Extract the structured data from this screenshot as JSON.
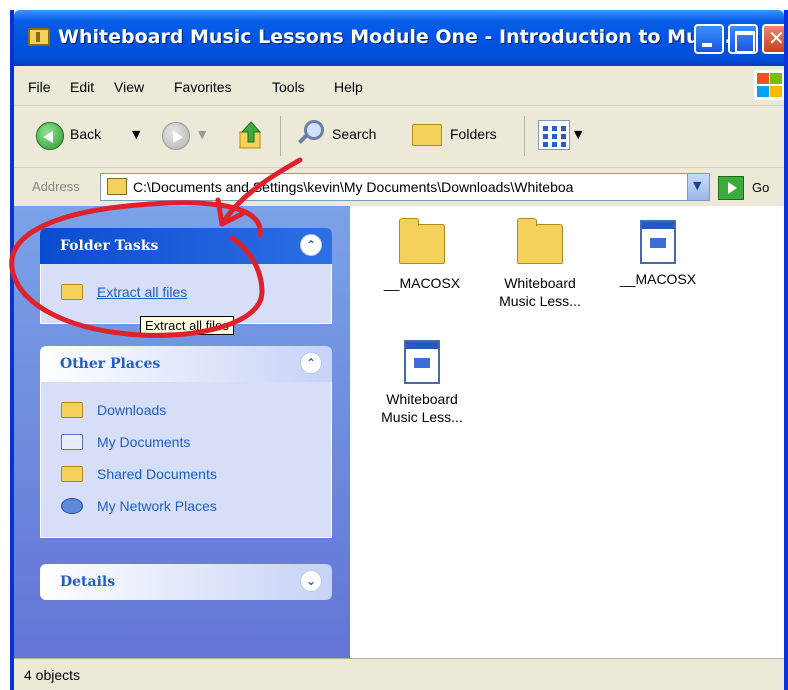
{
  "window": {
    "title": "Whiteboard Music Lessons Module One - Introduction to Musi...",
    "accent": "#0054e3"
  },
  "menu": [
    "File",
    "Edit",
    "View",
    "Favorites",
    "Tools",
    "Help"
  ],
  "toolbar": {
    "back": "Back",
    "search": "Search",
    "folders": "Folders"
  },
  "address": {
    "label": "Address",
    "path": "C:\\Documents and Settings\\kevin\\My Documents\\Downloads\\Whiteboa",
    "go": "Go"
  },
  "folder_tasks": {
    "title": "Folder Tasks",
    "items": [
      {
        "label": "Extract all files",
        "icon": "zip-folder-icon"
      }
    ],
    "tooltip": "Extract all files"
  },
  "other_places": {
    "title": "Other Places",
    "items": [
      {
        "label": "Downloads",
        "icon": "folder-icon"
      },
      {
        "label": "My Documents",
        "icon": "documents-icon"
      },
      {
        "label": "Shared Documents",
        "icon": "folder-icon"
      },
      {
        "label": "My Network Places",
        "icon": "network-icon"
      }
    ]
  },
  "details": {
    "title": "Details"
  },
  "files": [
    {
      "line1": "__MACOSX",
      "line2": "",
      "type": "folder"
    },
    {
      "line1": "Whiteboard",
      "line2": "Music Less...",
      "type": "folder"
    },
    {
      "line1": "__MACOSX",
      "line2": "",
      "type": "application"
    },
    {
      "line1": "Whiteboard",
      "line2": "Music Less...",
      "type": "application"
    }
  ],
  "status": {
    "text": "4 objects"
  },
  "annotation_color": "#e0202a"
}
